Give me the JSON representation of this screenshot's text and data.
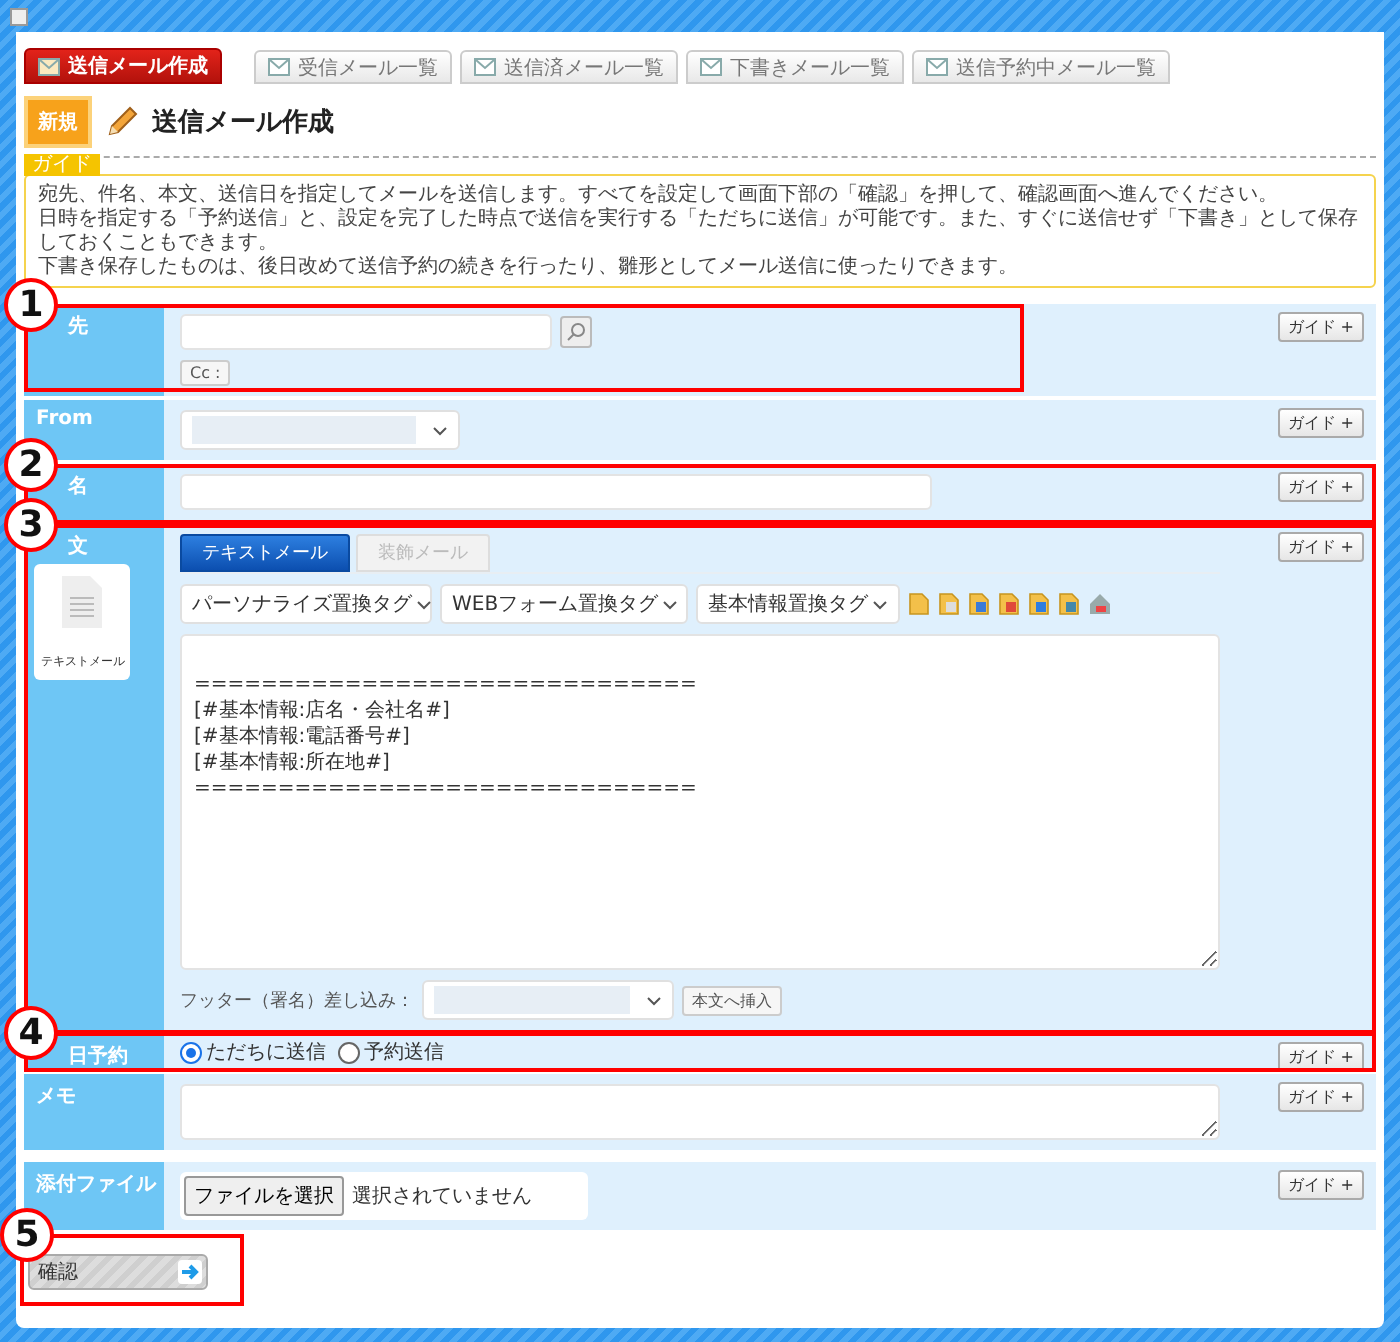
{
  "nav_tabs": [
    {
      "label": "送信メール作成",
      "selected": true
    },
    {
      "label": "受信メール一覧",
      "selected": false
    },
    {
      "label": "送信済メール一覧",
      "selected": false
    },
    {
      "label": "下書きメール一覧",
      "selected": false
    },
    {
      "label": "送信予約中メール一覧",
      "selected": false
    }
  ],
  "page_header": {
    "badge": "新規",
    "title": "送信メール作成"
  },
  "guide": {
    "tag": "ガイド",
    "lines": [
      "宛先、件名、本文、送信日を指定してメールを送信します。すべてを設定して画面下部の「確認」を押して、確認画面へ進んでください。",
      "日時を指定する「予約送信」と、設定を完了した時点で送信を実行する「ただちに送信」が可能です。また、すぐに送信せず「下書き」として保存しておくこともできます。",
      "下書き保存したものは、後日改めて送信予約の続きを行ったり、雛形としてメール送信に使ったりできます。"
    ]
  },
  "rows": [
    {
      "kind": "recipient",
      "label": "先",
      "annotation": "1",
      "guide_button": "ガイド +",
      "cc_button": "Cc :"
    },
    {
      "kind": "select",
      "label": "From",
      "guide_button": "ガイド +"
    },
    {
      "kind": "text",
      "label": "名",
      "annotation": "2",
      "guide_button": "ガイド +"
    },
    {
      "kind": "body",
      "label": "文",
      "annotation": "3",
      "guide_button": "ガイド +",
      "mail_tabs": [
        {
          "label": "テキストメール",
          "selected": true
        },
        {
          "label": "装飾メール",
          "selected": false
        }
      ],
      "mail_card": "テキストメール",
      "tag_selects": [
        "パーソナライズ置換タグ",
        "WEBフォーム置換タグ",
        "基本情報置換タグ"
      ],
      "body_lines": [
        "==============================",
        "[#基本情報:店名・会社名#]",
        "[#基本情報:電話番号#]",
        "[#基本情報:所在地#]",
        "=============================="
      ],
      "footer_label": "フッター（署名）差し込み：",
      "insert_button": "本文へ挿入"
    },
    {
      "kind": "schedule",
      "label": "日予約",
      "annotation": "4",
      "guide_button": "ガイド +",
      "options": [
        {
          "label": "ただちに送信",
          "selected": true
        },
        {
          "label": "予約送信",
          "selected": false
        }
      ]
    },
    {
      "kind": "memo",
      "label": "メモ",
      "guide_button": "ガイド +"
    },
    {
      "kind": "file",
      "label": "添付ファイル",
      "guide_button": "ガイド +",
      "file_button": "ファイルを選択",
      "file_status": "選択されていません"
    }
  ],
  "confirm": {
    "label": "確認",
    "annotation": "5"
  }
}
